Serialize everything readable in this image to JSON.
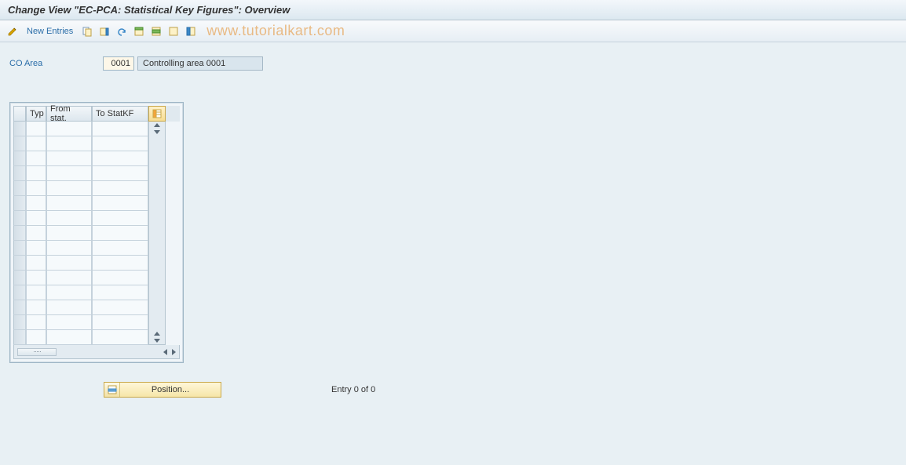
{
  "title": "Change View \"EC-PCA: Statistical Key Figures\": Overview",
  "toolbar": {
    "new_entries_label": "New Entries"
  },
  "watermark": "www.tutorialkart.com",
  "co_area": {
    "label": "CO Area",
    "code": "0001",
    "description": "Controlling area 0001"
  },
  "grid": {
    "headers": {
      "typ": "Typ",
      "from": "From stat.",
      "to": "To StatKF"
    },
    "row_count": 15,
    "rows": []
  },
  "position_button_label": "Position...",
  "entry_status": "Entry 0 of 0",
  "chart_data": {
    "type": "table",
    "columns": [
      "Typ",
      "From stat.",
      "To StatKF"
    ],
    "rows": []
  }
}
